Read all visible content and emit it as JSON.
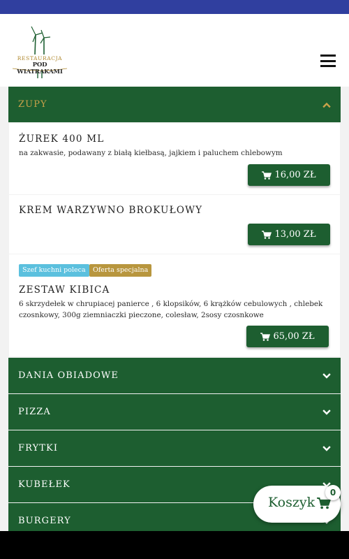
{
  "header": {
    "logo_line1": "RESTAURACJA",
    "logo_line2": "POD WIATRAKAMI"
  },
  "categories": {
    "zupy": "ZUPY",
    "dania_obiadowe": "DANIA OBIADOWE",
    "pizza": "PIZZA",
    "frytki": "FRYTKI",
    "kubelek": "KUBEŁEK",
    "burgery": "BURGERY"
  },
  "zupy_items": [
    {
      "title": "ŻUREK 400 ML",
      "description": "na zakwasie, podawany z białą kiełbasą, jajkiem i paluchem chlebowym",
      "price": "16,00 ZŁ"
    },
    {
      "title": "KREM WARZYWNO BROKUŁOWY",
      "price": "13,00 ZŁ"
    },
    {
      "badges": [
        "Szef kuchni poleca",
        "Oferta specjalna"
      ],
      "title": "ZESTAW KIBICA",
      "description_line1": "6 skrzydełek w chrupiacej panierce , 6 klopsików, 6 krążków cebulowych , chlebek",
      "description_line2": "czosnkowy, 300g ziemniaczki pieczone, colesław, 2sosy czosnkowe",
      "price": "65,00 ZŁ"
    }
  ],
  "cart": {
    "label": "Koszyk",
    "count": "0"
  },
  "icons": {
    "menu": "hamburger-icon",
    "expand": "chevron-down-icon",
    "collapse": "chevron-up-icon",
    "cart": "cart-icon"
  },
  "colors": {
    "brand_green": "#1d5e30",
    "accent_gold": "#c9a24a",
    "status_bar": "#303f9f",
    "badge_blue": "#5bc0de",
    "badge_gold": "#b8963e"
  }
}
